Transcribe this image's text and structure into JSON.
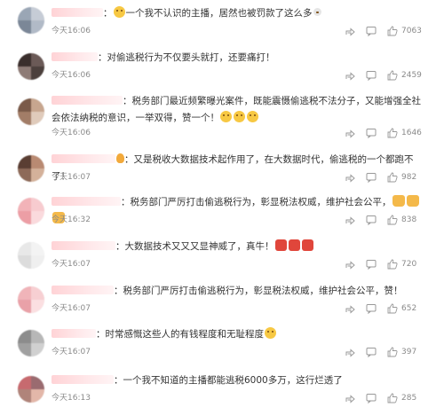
{
  "comments": [
    {
      "text": "一个我不认识的主播，居然也被罚款了这么多",
      "time": "今天16:06",
      "likes": "7063",
      "avatar_colors": [
        "#9aa6b5",
        "#c6ccd6",
        "#7b8797",
        "#b1bac7"
      ]
    },
    {
      "text": "对偷逃税行为不仅要头就打，还要痛打！",
      "time": "今天16:06",
      "likes": "2459",
      "avatar_colors": [
        "#3a2e2c",
        "#6b5a57",
        "#8e7b76",
        "#4c403d"
      ]
    },
    {
      "text": "税务部门最近频繁曝光案件，既能震慑偷逃税不法分子，又能增强全社会依法纳税的意识，一举双得，赞一个！",
      "time": "今天16:06",
      "likes": "1646",
      "avatar_colors": [
        "#7a5a49",
        "#c7a68f",
        "#a27d67",
        "#e0cbbb"
      ]
    },
    {
      "text": "又是税收大数据技术起作用了，在大数据时代，偷逃税的一个都跑不了！",
      "time": "今天16:07",
      "likes": "982",
      "avatar_colors": [
        "#5a3e33",
        "#b98a72",
        "#8d6a59",
        "#d4b19a"
      ]
    },
    {
      "text": "税务部门严厉打击偷逃税行为，彰显税法权威，维护社会公平，",
      "time": "今天16:32",
      "likes": "838",
      "avatar_colors": [
        "#f2b3b8",
        "#f7cbcf",
        "#ec9ea5",
        "#fadadd"
      ]
    },
    {
      "text": "大数据技术又又又显神威了，真牛！",
      "time": "今天16:07",
      "likes": "720",
      "avatar_colors": [
        "#e8e8e8",
        "#f3f3f3",
        "#dcdcdc",
        "#efefef"
      ]
    },
    {
      "text": "税务部门严厉打击偷逃税行为，彰显税法权威，维护社会公平，赞！",
      "time": "今天16:07",
      "likes": "652",
      "avatar_colors": [
        "#f0b4b9",
        "#f7cfd2",
        "#e9a1a8",
        "#fbdfe1"
      ]
    },
    {
      "text": "时常感慨这些人的有钱程度和无耻程度",
      "time": "今天16:07",
      "likes": "397",
      "avatar_colors": [
        "#8c8c8c",
        "#b7b7b7",
        "#a0a0a0",
        "#d0d0d0"
      ]
    },
    {
      "text": "一个我不知道的主播都能逃税6000多万，这行烂透了",
      "time": "今天16:13",
      "likes": "285",
      "avatar_colors": [
        "#c76a6f",
        "#9a6b70",
        "#b0847a",
        "#e3b7a9"
      ]
    }
  ]
}
